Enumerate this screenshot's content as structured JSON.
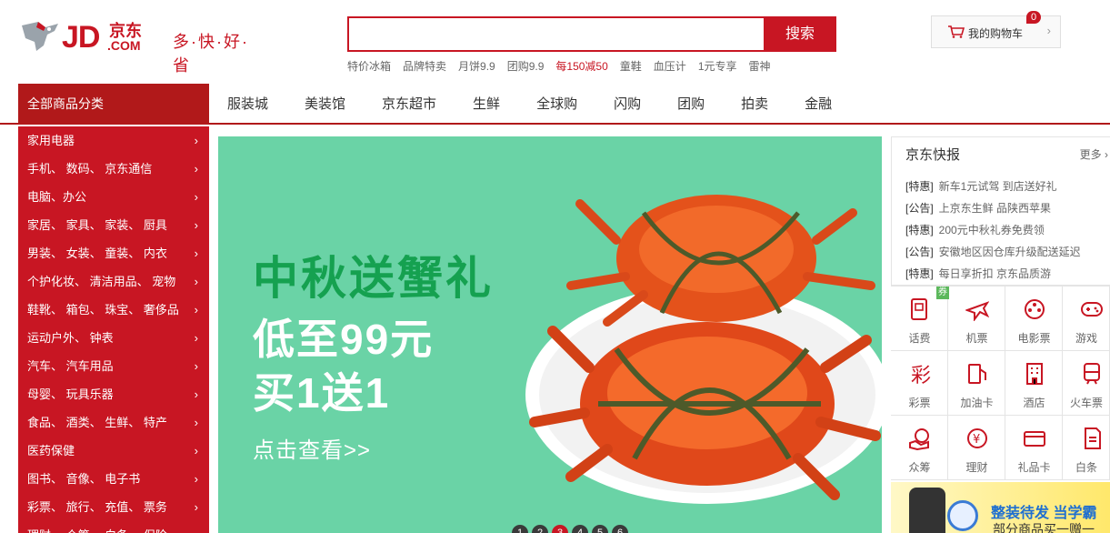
{
  "header": {
    "logo_text": "JD",
    "logo_cn": "京东",
    "logo_com": ".COM",
    "slogan": "多·快·好·省",
    "search": {
      "value": "",
      "placeholder": "",
      "button": "搜索"
    },
    "hotwords": [
      "特价冰箱",
      "品牌特卖",
      "月饼9.9",
      "团购9.9",
      "每150减50",
      "童鞋",
      "血压计",
      "1元专享",
      "雷神"
    ],
    "hotword_highlight": [
      4
    ],
    "cart": {
      "label": "我的购物车",
      "count": "0"
    }
  },
  "nav": {
    "category_title": "全部商品分类",
    "items": [
      "服装城",
      "美装馆",
      "京东超市",
      "生鲜",
      "全球购",
      "闪购",
      "团购",
      "拍卖",
      "金融"
    ]
  },
  "categories": [
    "家用电器",
    "手机、 数码、 京东通信",
    "电脑、办公",
    "家居、 家具、 家装、 厨具",
    "男装、 女装、 童装、 内衣",
    "个护化妆、 清洁用品、 宠物",
    "鞋靴、 箱包、 珠宝、 奢侈品",
    "运动户外、 钟表",
    "汽车、 汽车用品",
    "母婴、 玩具乐器",
    "食品、 酒类、 生鲜、 特产",
    "医药保健",
    "图书、 音像、 电子书",
    "彩票、 旅行、 充值、 票务",
    "理财、 众筹、 白条、 保险"
  ],
  "banner": {
    "title": "中秋送蟹礼",
    "line2": "低至99元",
    "line3": "买1送1",
    "cta": "点击查看>>",
    "dots": [
      "1",
      "2",
      "3",
      "4",
      "5",
      "6"
    ],
    "active_dot": 2
  },
  "news": {
    "title": "京东快报",
    "more": "更多 ›",
    "items": [
      {
        "tag": "[特惠]",
        "text": "新车1元试驾 到店送好礼"
      },
      {
        "tag": "[公告]",
        "text": "上京东生鲜 品陕西苹果"
      },
      {
        "tag": "[特惠]",
        "text": "200元中秋礼券免费领"
      },
      {
        "tag": "[公告]",
        "text": "安徽地区因仓库升级配送延迟"
      },
      {
        "tag": "[特惠]",
        "text": "每日享折扣 京东品质游"
      }
    ]
  },
  "services": [
    {
      "label": "话费",
      "icon": "phone-bill-icon",
      "tag": "券"
    },
    {
      "label": "机票",
      "icon": "plane-icon"
    },
    {
      "label": "电影票",
      "icon": "film-icon"
    },
    {
      "label": "游戏",
      "icon": "gamepad-icon"
    },
    {
      "label": "彩票",
      "icon": "lottery-icon"
    },
    {
      "label": "加油卡",
      "icon": "fuel-icon"
    },
    {
      "label": "酒店",
      "icon": "hotel-icon"
    },
    {
      "label": "火车票",
      "icon": "train-icon"
    },
    {
      "label": "众筹",
      "icon": "crowdfund-icon"
    },
    {
      "label": "理财",
      "icon": "finance-icon"
    },
    {
      "label": "礼品卡",
      "icon": "giftcard-icon"
    },
    {
      "label": "白条",
      "icon": "iou-icon"
    }
  ],
  "ad": {
    "line1": "整装待发 当学霸",
    "line2": "部分商品买一赠一"
  },
  "colors": {
    "brand": "#c81623",
    "banner_bg": "#6ad3a6",
    "banner_title": "#15a150"
  }
}
